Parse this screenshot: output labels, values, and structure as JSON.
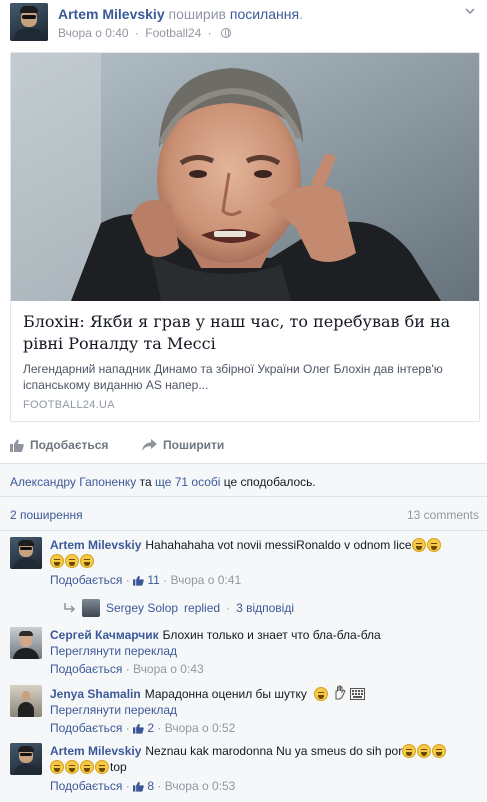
{
  "post": {
    "author": "Artem Milevskiy",
    "action": "поширив",
    "action_link": "посилання",
    "action_end": ".",
    "time": "Вчора о 0:40",
    "dot": "·",
    "source": "Football24",
    "dot2": "·"
  },
  "link_card": {
    "title": "Блохін: Якби я грав у наш час, то перебував би на рівні Роналду та Мессі",
    "description": "Легендарний нападник Динамо та збірної України Олег Блохін дав інтерв'ю іспанському виданню AS напер...",
    "domain": "FOOTBALL24.UA"
  },
  "actions": {
    "like_label": "Подобається",
    "share_label": "Поширити"
  },
  "likes": {
    "person": "Александру Гапоненку",
    "connector": "та",
    "others": "ще 71 особі",
    "suffix": "це сподобалось."
  },
  "shares": {
    "count_label": "2 поширення",
    "comments_label": "13 comments"
  },
  "comments": [
    {
      "name": "Artem Milevskiy",
      "text": "Hahahahaha vot novii messiRonaldo v odnom lice",
      "like_label": "Подобається",
      "dot": "·",
      "likes": "11",
      "time": "Вчора о 0:41",
      "replies": {
        "name": "Sergey Solop",
        "replied": "replied",
        "dot": "·",
        "count": "3 відповіді"
      }
    },
    {
      "name": "Сергей Качмарчик",
      "text": "Блохин только и знает что бла-бла-бла",
      "translate": "Переглянути переклад",
      "like_label": "Подобається",
      "dot": "·",
      "time": "Вчора о 0:43"
    },
    {
      "name": "Jenya Shamalin",
      "text": "Марадонна оценил бы шутку",
      "translate": "Переглянути переклад",
      "like_label": "Подобається",
      "dot": "·",
      "likes": "2",
      "time": "Вчора о 0:52"
    },
    {
      "name": "Artem Milevskiy",
      "text": "Neznau kak marodonna Nu ya smeus do sih por",
      "text_tail": "top",
      "like_label": "Подобається",
      "dot": "·",
      "likes": "8",
      "time": "Вчора о 0:53"
    }
  ],
  "colors": {
    "link": "#3b5998",
    "muted": "#9197a3",
    "panel": "#f6f7f9"
  }
}
